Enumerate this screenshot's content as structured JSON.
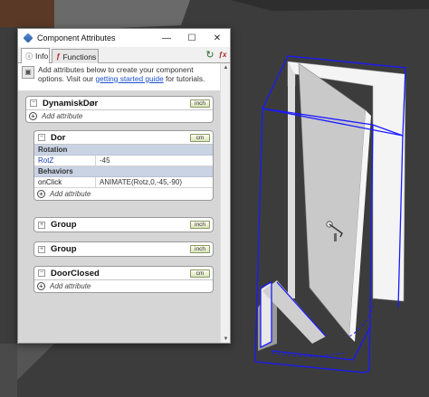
{
  "window": {
    "title": "Component Attributes",
    "minimize": "—",
    "maximize": "☐",
    "close": "✕"
  },
  "tabs": [
    {
      "label": "Info",
      "active": true
    },
    {
      "label": "Functions",
      "active": false
    }
  ],
  "info": {
    "text_before": "Add attributes below to create your component options. Visit our ",
    "link": "getting started guide",
    "text_after": " for tutorials."
  },
  "components": [
    {
      "name": "DynamiskDør",
      "unit": "inch",
      "expanded": false,
      "add_label": "Add attribute"
    },
    {
      "name": "Dor",
      "unit": "cm",
      "expanded": true,
      "sections": [
        {
          "title": "Rotation",
          "rows": [
            {
              "name": "RotZ",
              "value": "-45"
            }
          ]
        },
        {
          "title": "Behaviors",
          "rows": [
            {
              "name": "onClick",
              "value": "ANIMATE(Rotz,0,-45,-90)"
            }
          ]
        }
      ],
      "add_label": "Add attribute"
    },
    {
      "name": "Group",
      "unit": "inch",
      "expanded": false
    },
    {
      "name": "Group",
      "unit": "inch",
      "expanded": false
    },
    {
      "name": "DoorClosed",
      "unit": "cm",
      "expanded": false,
      "add_label": "Add attribute"
    }
  ],
  "colors": {
    "selection_blue": "#1a1aff",
    "viewport_bg": "#3a3a3a",
    "link": "#1a4fd0"
  }
}
